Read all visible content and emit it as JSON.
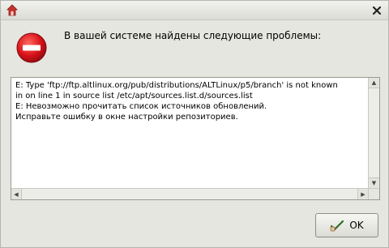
{
  "dialog": {
    "message": "В вашей системе найдены следующие проблемы:",
    "details_text": "E: Type 'ftp://ftp.altlinux.org/pub/distributions/ALTLinux/p5/branch' is not known\nin on line 1 in source list /etc/apt/sources.list.d/sources.list\nE: Невозможно прочитать список источников обновлений.\nИсправьте ошибку в окне настройки репозиториев.",
    "ok_label": "OK"
  },
  "icons": {
    "title_icon": "app-icon",
    "close_icon": "close-icon",
    "error_icon": "error-icon",
    "ok_icon": "check-hand-icon"
  },
  "colors": {
    "error_red": "#d8121a",
    "window_bg": "#e6e6e1"
  }
}
